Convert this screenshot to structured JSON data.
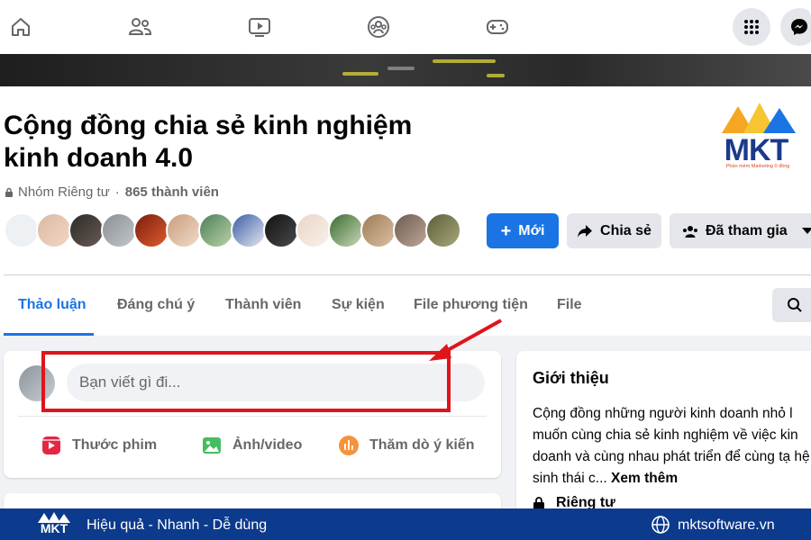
{
  "nav": {
    "icons": [
      "home-icon",
      "friends-icon",
      "watch-icon",
      "groups-icon",
      "gaming-icon"
    ],
    "right_icons": [
      "menu-grid-icon",
      "messenger-icon"
    ]
  },
  "group": {
    "title": "Cộng đồng chia sẻ kinh nghiệm kinh doanh 4.0",
    "privacy": "Nhóm Riêng tư",
    "members": "865 thành viên"
  },
  "buttons": {
    "new": "Mới",
    "share": "Chia sẻ",
    "joined": "Đã tham gia"
  },
  "tabs": [
    "Thảo luận",
    "Đáng chú ý",
    "Thành viên",
    "Sự kiện",
    "File phương tiện",
    "File"
  ],
  "composer": {
    "placeholder": "Bạn viết gì đi...",
    "actions": [
      "Thước phim",
      "Ảnh/video",
      "Thăm dò ý kiến"
    ]
  },
  "intro": {
    "heading": "Giới thiệu",
    "text": "Cộng đồng những người kinh doanh nhỏ l muốn cùng chia sẻ kinh nghiệm về việc kin doanh và cùng nhau phát triển để cùng tạ hệ sinh thái c...",
    "more": "Xem thêm",
    "privacy_label": "Riêng tư"
  },
  "watermark": {
    "brand": "MKT",
    "tagline": "Phần mềm Marketing 0 đồng"
  },
  "banner": {
    "brand": "MKT",
    "slogan": "Hiệu quả - Nhanh - Dễ dùng",
    "site": "mktsoftware.vn"
  },
  "colors": {
    "accent": "#1b74e4",
    "highlight": "#e0141b",
    "banner": "#0c3a8c"
  }
}
